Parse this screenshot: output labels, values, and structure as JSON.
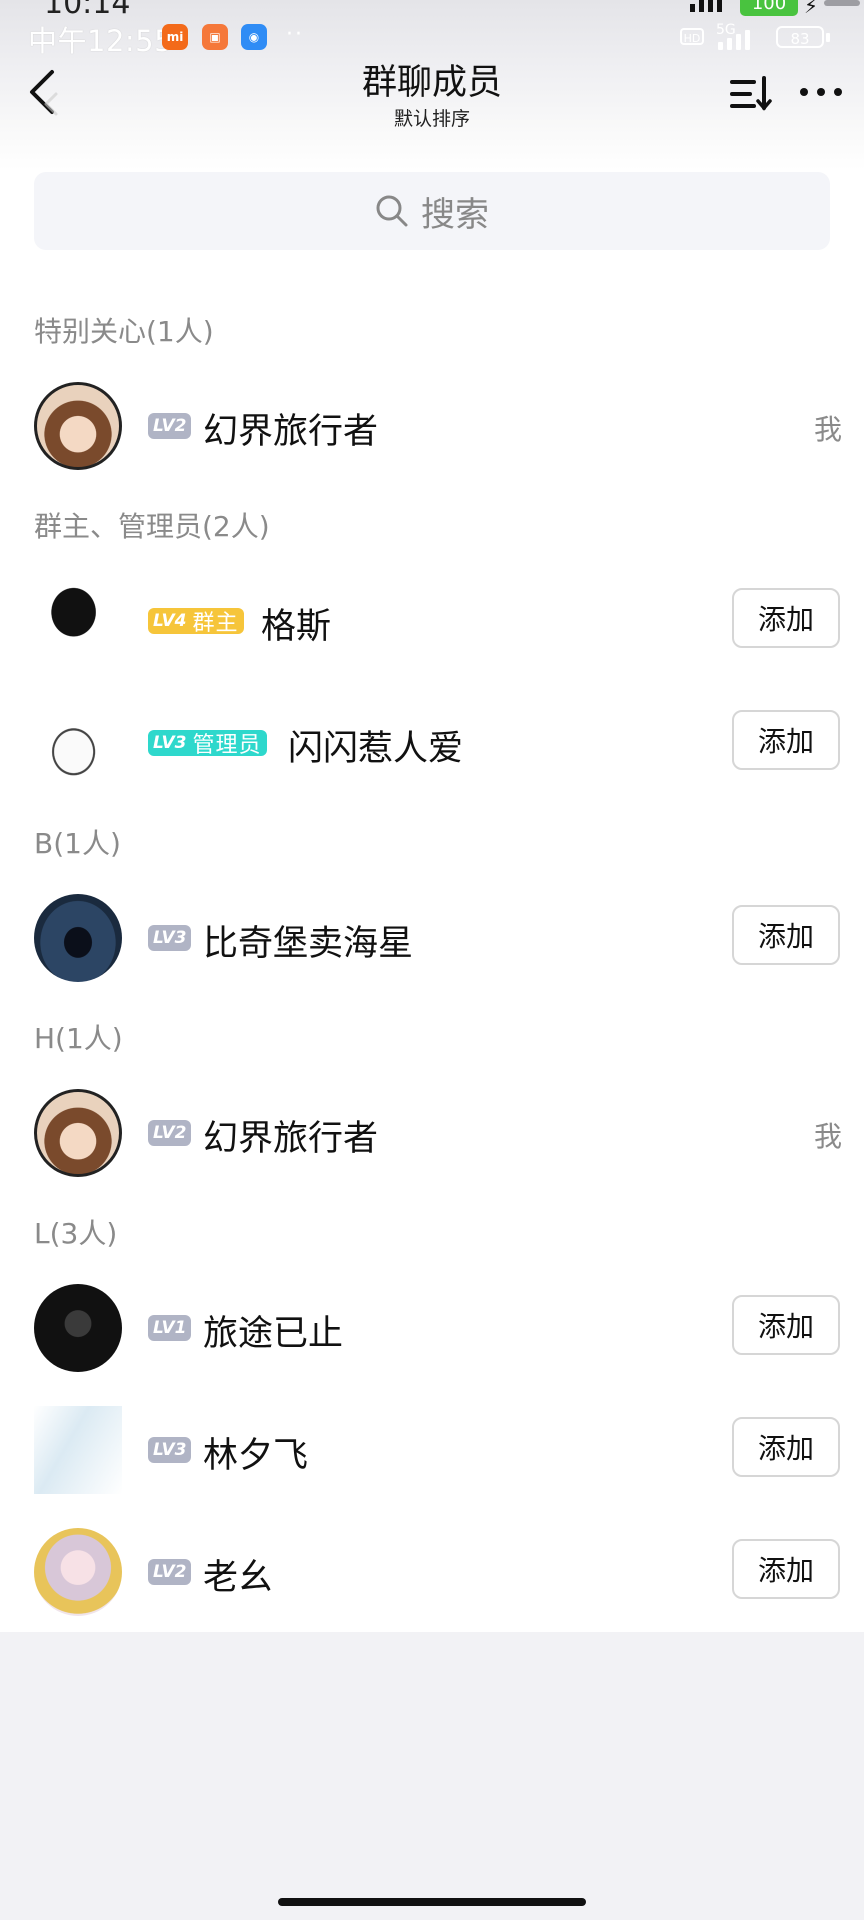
{
  "ghost": {
    "time": "10:14",
    "battery": "100"
  },
  "status_bar": {
    "time": "中午12:55",
    "app1": "mi",
    "dots": "··",
    "hd": "HD",
    "net": "5G",
    "battery": "83"
  },
  "nav": {
    "title": "群聊成员",
    "subtitle": "默认排序"
  },
  "search": {
    "placeholder": "搜索"
  },
  "sections": [
    {
      "label": "特别关心(1人)"
    },
    {
      "label": "群主、管理员(2人)"
    },
    {
      "label": "B(1人)"
    },
    {
      "label": "H(1人)"
    },
    {
      "label": "L(3人)"
    }
  ],
  "members": [
    {
      "level": "LV2",
      "role": "",
      "name": "幻界旅行者",
      "action": "我"
    },
    {
      "level": "LV4",
      "role": "群主",
      "name": "格斯",
      "action": "添加"
    },
    {
      "level": "LV3",
      "role": "管理员",
      "name": "闪闪惹人爱",
      "action": "添加"
    },
    {
      "level": "LV3",
      "role": "",
      "name": "比奇堡卖海星",
      "action": "添加"
    },
    {
      "level": "LV2",
      "role": "",
      "name": "幻界旅行者",
      "action": "我"
    },
    {
      "level": "LV1",
      "role": "",
      "name": "旅途已止",
      "action": "添加"
    },
    {
      "level": "LV3",
      "role": "",
      "name": "林夕飞",
      "action": "添加"
    },
    {
      "level": "LV2",
      "role": "",
      "name": "老幺",
      "action": "添加"
    }
  ],
  "colors": {
    "level_gray": "#b0b4c5",
    "owner_gold": "#f6c53a",
    "admin_teal": "#2ed8cc"
  }
}
